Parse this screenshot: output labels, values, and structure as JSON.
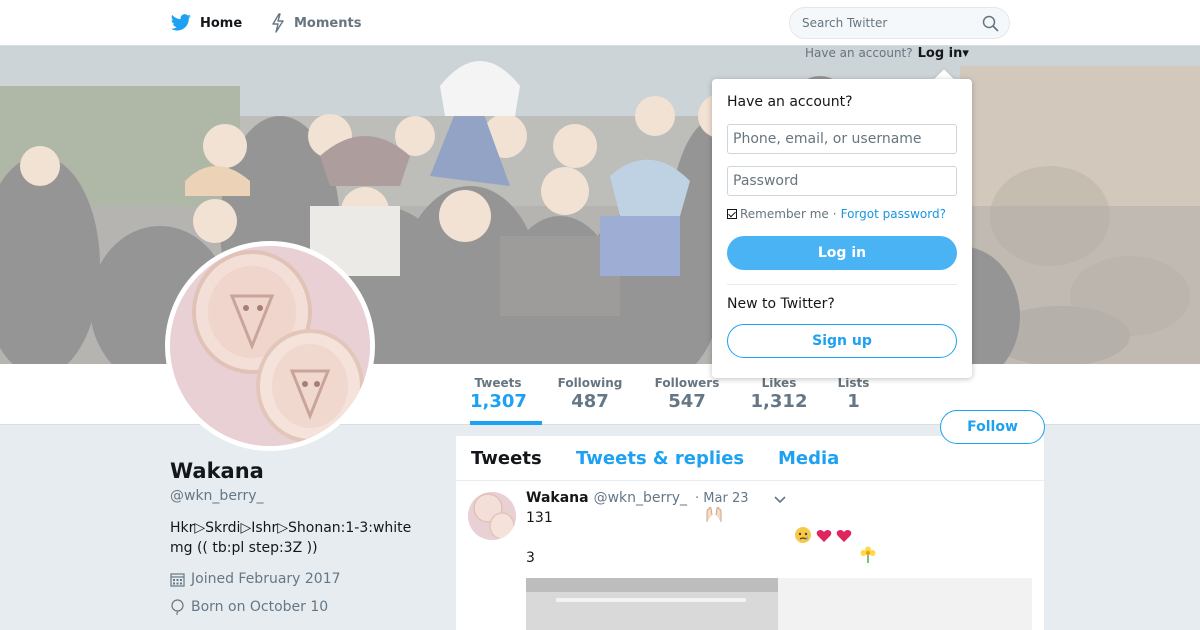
{
  "nav": {
    "home_label": "Home",
    "moments_label": "Moments",
    "search_placeholder": "Search Twitter"
  },
  "account_bar": {
    "prompt": "Have an account?",
    "login_label": "Log in",
    "caret": "▾"
  },
  "login_dropdown": {
    "title": "Have an account?",
    "username_placeholder": "Phone, email, or username",
    "password_placeholder": "Password",
    "remember_label": "Remember me",
    "separator": "·",
    "forgot_label": "Forgot password?",
    "remember_checked": true,
    "login_button": "Log in",
    "new_prompt": "New to Twitter?",
    "signup_button": "Sign up"
  },
  "stats": [
    {
      "label": "Tweets",
      "value": "1,307",
      "active": true
    },
    {
      "label": "Following",
      "value": "487",
      "active": false
    },
    {
      "label": "Followers",
      "value": "547",
      "active": false
    },
    {
      "label": "Likes",
      "value": "1,312",
      "active": false
    },
    {
      "label": "Lists",
      "value": "1",
      "active": false
    }
  ],
  "follow_button": "Follow",
  "profile": {
    "name": "Wakana",
    "handle": "@wkn_berry_",
    "bio_line1": "Hkr▷Skrdi▷Ishr▷Shonan:1-3:white",
    "bio_line2": "mg (( tb:pl step:3Z ))",
    "joined": "Joined February 2017",
    "born": "Born on October 10"
  },
  "timeline": {
    "tabs": [
      "Tweets",
      "Tweets & replies",
      "Media"
    ],
    "active_tab": "Tweets"
  },
  "tweet": {
    "name": "Wakana",
    "handle": "@wkn_berry_",
    "date": "· Mar 23",
    "line1": "131",
    "line2": "3",
    "emoji_hands": "🙌🏻",
    "emoji_face": "😢",
    "emoji_heart": "💗",
    "emoji_flower": "🌼"
  },
  "colors": {
    "accent": "#1da1f2",
    "login_button": "#4ab3f4",
    "background": "#e6ecf0",
    "avatar": "#e8cfd4"
  }
}
